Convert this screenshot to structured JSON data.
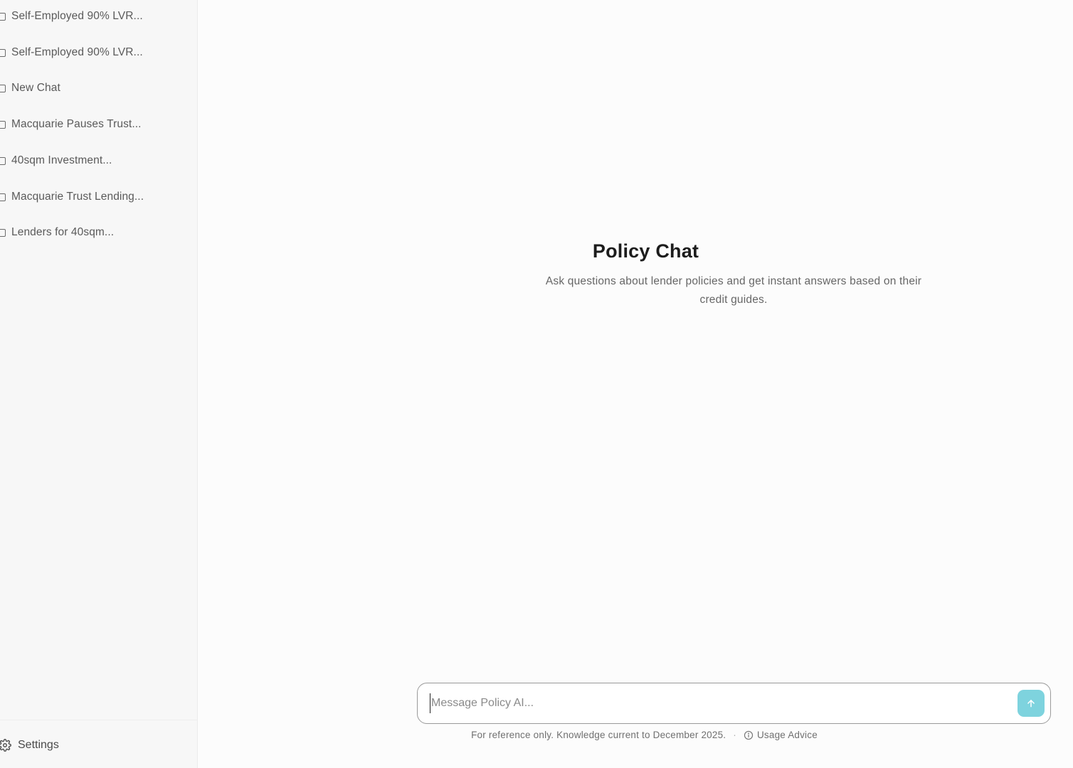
{
  "sidebar": {
    "chats": [
      {
        "label": "Self-Employed 90% LVR..."
      },
      {
        "label": "Self-Employed 90% LVR..."
      },
      {
        "label": "New Chat"
      },
      {
        "label": "Macquarie Pauses Trust..."
      },
      {
        "label": "40sqm Investment..."
      },
      {
        "label": "Macquarie Trust Lending..."
      },
      {
        "label": "Lenders for 40sqm..."
      }
    ],
    "settings_label": "Settings"
  },
  "main": {
    "title": "Policy Chat",
    "subtitle": "Ask questions about lender policies and get instant answers based on their credit guides.",
    "composer": {
      "placeholder": "Message Policy AI...",
      "value": ""
    },
    "footnote": "For reference only. Knowledge current to December 2025.",
    "separator": "·",
    "usage_label": "Usage Advice"
  },
  "colors": {
    "accent": "#7ed3de"
  }
}
